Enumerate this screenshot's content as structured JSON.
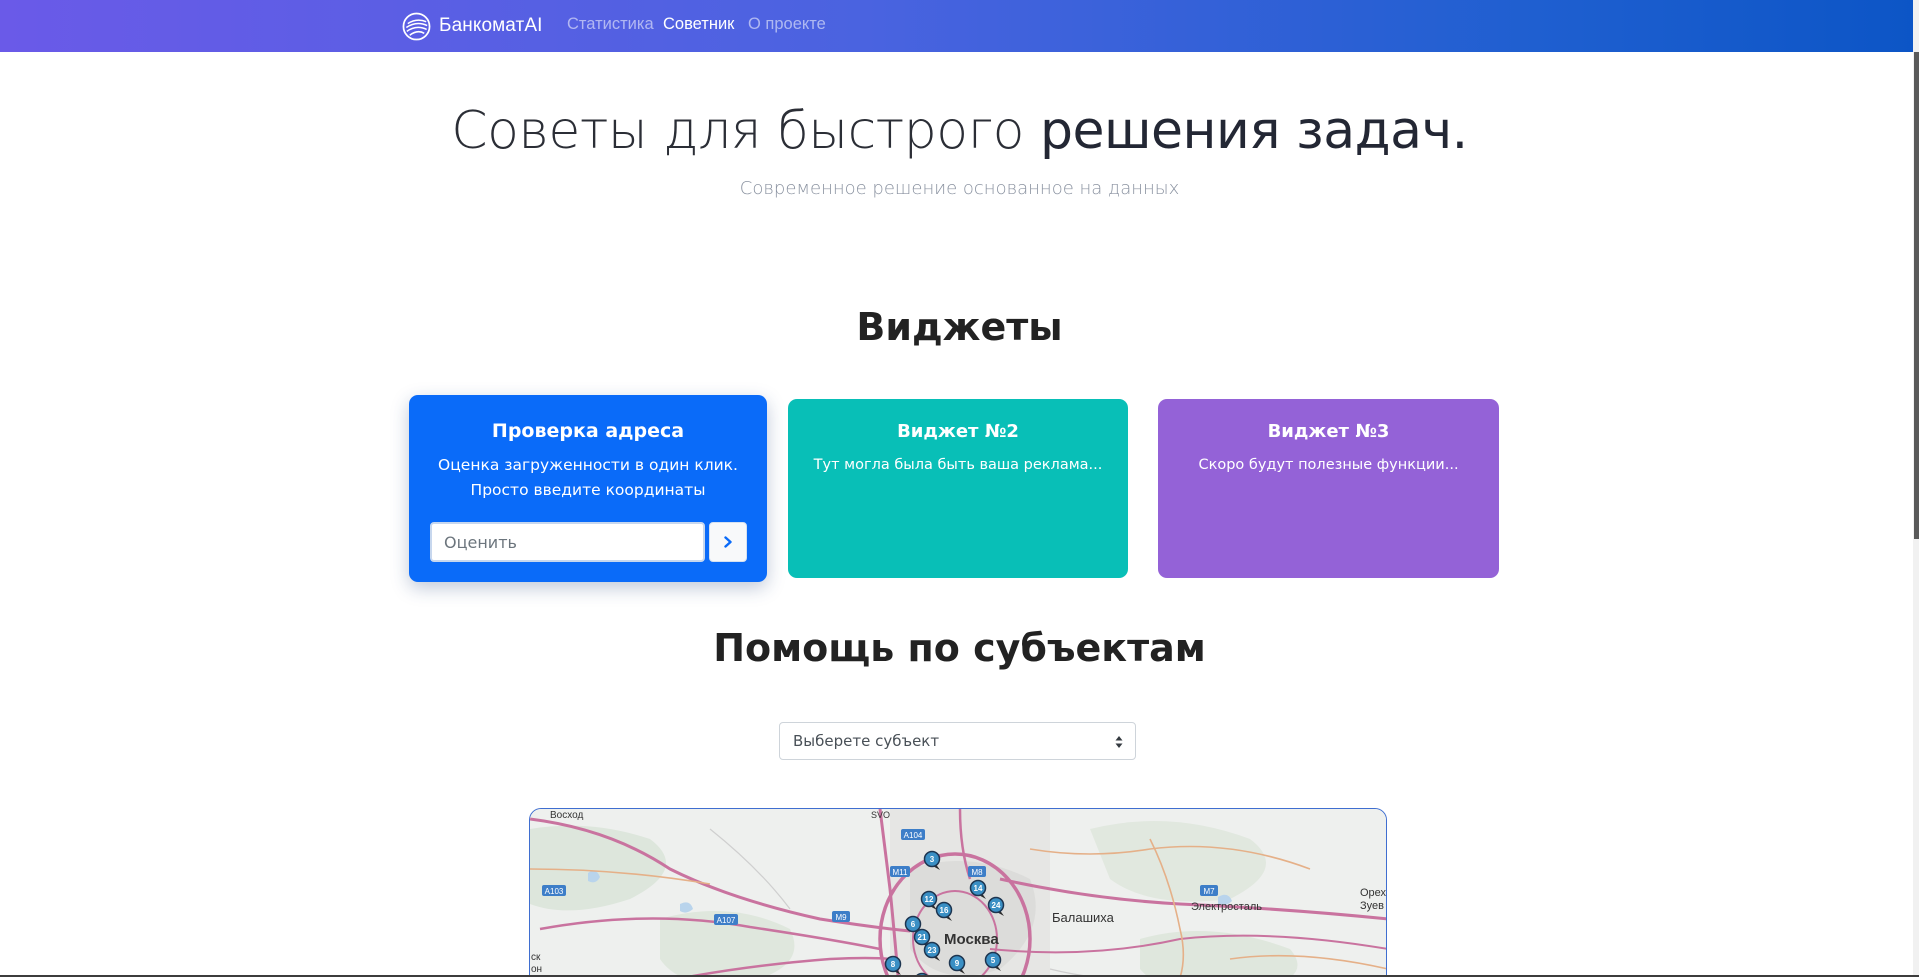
{
  "navbar": {
    "brand": "БанкоматAI",
    "links": [
      {
        "label": "Статистика",
        "active": false
      },
      {
        "label": "Советник",
        "active": true
      },
      {
        "label": "О проекте",
        "active": false
      }
    ],
    "gradient_colors": [
      "#6a5ae8",
      "#0c55c6"
    ]
  },
  "hero": {
    "title_light": "Советы для быстрого ",
    "title_strong": "решения задач.",
    "subtitle": "Современное решение основанное на данных"
  },
  "widgets_section": {
    "title": "Виджеты",
    "cards": [
      {
        "title": "Проверка адреса",
        "text_line1": "Оценка загруженности в один клик.",
        "text_line2": "Просто введите координаты",
        "input_placeholder": "Оценить",
        "button_icon": "chevron-right-icon",
        "color": "#0a6bf9"
      },
      {
        "title": "Виджет №2",
        "text": "Тут могла была быть ваша реклама...",
        "color": "#08bfb7"
      },
      {
        "title": "Виджет №3",
        "text": "Скоро будут полезные функции...",
        "color": "#9462d7"
      }
    ]
  },
  "subjects_section": {
    "title": "Помощь по субъектам",
    "select_value": "Выберете субъект"
  },
  "map": {
    "labels": {
      "voskhod": "Восход",
      "svo": "SVO",
      "moscow": "Москва",
      "balashikha": "Балашиха",
      "elektrostal": "Электросталь",
      "orekhovo_1": "Орех",
      "orekhovo_2": "Зуев",
      "sk_1": "ск",
      "sk_2": "он"
    },
    "road_badges": [
      "А104",
      "М11",
      "М8",
      "А103",
      "А107",
      "М9",
      "М7"
    ],
    "markers": [
      "3",
      "14",
      "12",
      "24",
      "16",
      "6",
      "21",
      "23",
      "8",
      "5",
      "9",
      "13"
    ]
  }
}
